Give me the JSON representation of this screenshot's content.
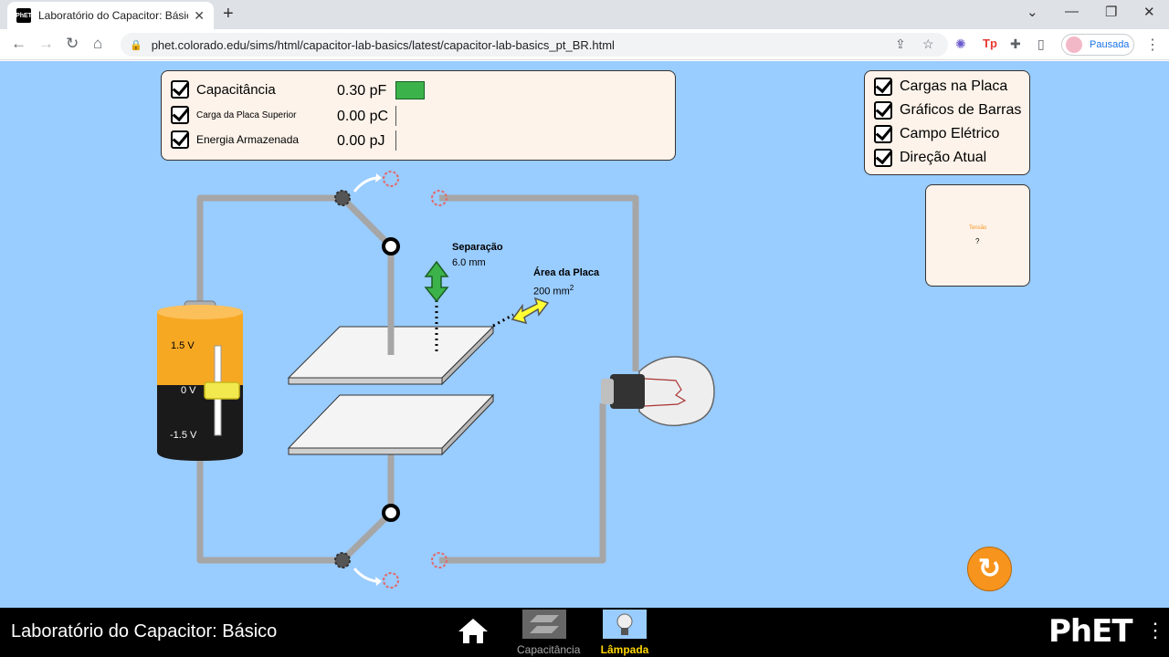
{
  "browser": {
    "tab_title": "Laboratório do Capacitor: Básico",
    "favicon_text": "PhET",
    "new_tab": "+",
    "url": "phet.colorado.edu/sims/html/capacitor-lab-basics/latest/capacitor-lab-basics_pt_BR.html",
    "profile_label": "Pausada",
    "ext_tp": "Tp"
  },
  "meters": [
    {
      "label": "Capacitância",
      "value": "0.30 pF"
    },
    {
      "label": "Carga da Placa Superior",
      "value": "0.00 pC"
    },
    {
      "label": "Energia Armazenada",
      "value": "0.00 pJ"
    }
  ],
  "options": [
    {
      "label": "Cargas na Placa"
    },
    {
      "label": "Gráficos de Barras"
    },
    {
      "label": "Campo Elétrico"
    },
    {
      "label": "Direção Atual"
    }
  ],
  "battery": {
    "top_label": "1.5 V",
    "mid_label": "0 V",
    "bottom_label": "-1.5 V",
    "voltage_fraction": 0.5
  },
  "separation": {
    "label": "Separação",
    "value": "6.0 mm"
  },
  "plate_area": {
    "label": "Área da Placa",
    "value": "200 mm",
    "exp": "2"
  },
  "voltmeter": {
    "label": "Tensão",
    "reading": "?"
  },
  "navbar": {
    "title": "Laboratório do Capacitor: Básico",
    "screens": [
      {
        "label": "Capacitância",
        "selected": false
      },
      {
        "label": "Lâmpada",
        "selected": true
      }
    ],
    "logo": "PhET"
  },
  "colors": {
    "sim_bg": "#99ccff",
    "panel_bg": "#fdf3ea",
    "bar_green": "#3cb34a",
    "selected_screen": "#ffd700",
    "reset_orange": "#f7941d"
  }
}
